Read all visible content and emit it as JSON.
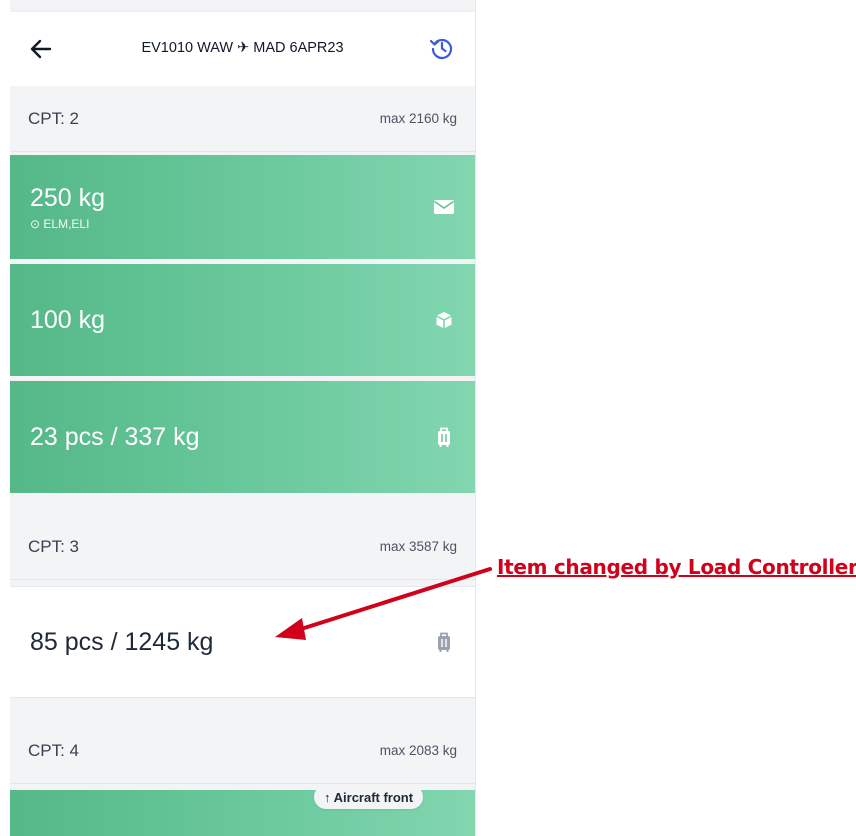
{
  "header": {
    "title": "EV1010 WAW ✈ MAD 6APR23"
  },
  "compartments": [
    {
      "title": "CPT: 2",
      "max": "max 2160 kg",
      "items": [
        {
          "main": "250 kg",
          "sub": "ELM,ELI",
          "icon": "envelope-icon"
        },
        {
          "main": "100 kg",
          "icon": "box-icon"
        },
        {
          "main": "23 pcs / 337 kg",
          "icon": "luggage-icon"
        }
      ]
    },
    {
      "title": "CPT: 3",
      "max": "max 3587 kg",
      "items": [
        {
          "main": "85 pcs / 1245 kg",
          "icon": "luggage-icon"
        }
      ]
    },
    {
      "title": "CPT: 4",
      "max": "max 2083 kg"
    }
  ],
  "aircraft_front_label": "↑ Aircraft front",
  "annotation": "Item changed by Load Controller",
  "colors": {
    "accent": "#5fbf90",
    "annotation": "#d0021b",
    "history_icon": "#3b5bdb"
  }
}
